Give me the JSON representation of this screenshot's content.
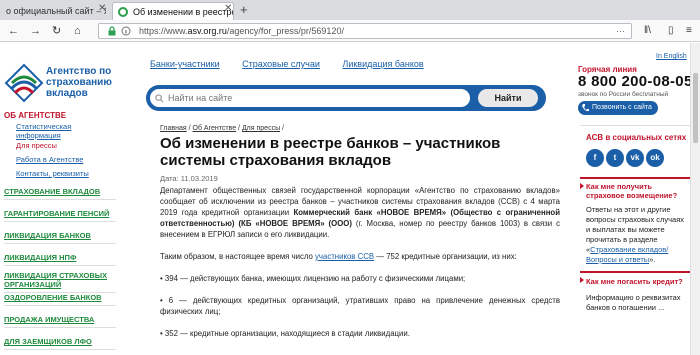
{
  "browser": {
    "tabs": [
      {
        "label": "о официальный сайт – Ян…",
        "active": false
      },
      {
        "label": "Об изменении в реестре банк…",
        "active": true
      }
    ],
    "url_scheme": "https://www.",
    "url_domain": "asv.org.ru",
    "url_path": "/agency/for_press/pr/569120/",
    "url_menu": "···"
  },
  "site": {
    "logo_text": "Агентство по страхованию вкладов",
    "top_links": [
      "Банки-участники",
      "Страховые случаи",
      "Ликвидация банков"
    ],
    "search": {
      "placeholder": "Найти на сайте",
      "button": "Найти"
    },
    "lang_link": "In English",
    "hotline_label": "Горячая линия",
    "phone": "8 800 200-08-05",
    "free_note": "звонок по России бесплатный",
    "callback_button": "Позвонить с сайта"
  },
  "left_menu": {
    "heading": "ОБ АГЕНТСТВЕ",
    "subitems": [
      "Статистическая информация",
      "Для прессы",
      "Работа в Агентстве",
      "Контакты, реквизиты"
    ],
    "items": [
      "СТРАХОВАНИЕ ВКЛАДОВ",
      "ГАРАНТИРОВАНИЕ ПЕНСИЙ",
      "ЛИКВИДАЦИЯ БАНКОВ",
      "ЛИКВИДАЦИЯ НПФ",
      "ЛИКВИДАЦИЯ СТРАХОВЫХ ОРГАНИЗАЦИЙ",
      "ОЗДОРОВЛЕНИЕ БАНКОВ",
      "ПРОДАЖА ИМУЩЕСТВА",
      "ДЛЯ ЗАЕМЩИКОВ ЛФО"
    ]
  },
  "article": {
    "breadcrumb": [
      "Главная",
      "Об Агентстве",
      "Для прессы"
    ],
    "title": "Об изменении в реестре банков – участников системы страхования вкладов",
    "date": "Дата: 11.03.2019",
    "p1_pre": "Департамент общественных связей государственной корпорации «Агентство по страхованию вкладов» сообщает об исключении из реестра банков – участников системы страхования вкладов (ССВ) с 4 марта 2019 года кредитной организации ",
    "p1_bold": "Коммерческий банк «НОВОЕ ВРЕМЯ» (Общество с ограниченной ответственностью) (КБ «НОВОЕ ВРЕМЯ» (ООО)",
    "p1_post": " (г. Москва, номер по реестру банков 1003) в связи с внесением в ЕГРЮЛ записи о его ликвидации.",
    "p2_pre": "Таким образом, в настоящее время число ",
    "p2_link": "участников ССВ",
    "p2_post": " — 752 кредитные организации, из них:",
    "p3": "• 394 — действующих банка, имеющих лицензию на работу с физическими лицами;",
    "p4": "• 6 — действующих кредитных организаций, утративших право на привлечение денежных средств физических лиц;",
    "p5": "• 352 — кредитные организации, находящиеся в стадии ликвидации."
  },
  "right_col": {
    "social_heading": "АСВ в социальных сетях",
    "social": [
      "f",
      "t",
      "vk",
      "ok"
    ],
    "q1": "Как мне получить страховое возмещение?",
    "a1_pre": "Ответы на этот и другие вопросы страховых случаях и выплатах вы можете прочитать в разделе «",
    "a1_link": "Страхование вкладов/Вопросы и ответы",
    "a1_post": "».",
    "q2": "Как мне погасить кредит?",
    "a2": "Информацию о реквизитах банков о погашении ..."
  },
  "colors": {
    "brand_blue": "#1a5fa8",
    "accent_red": "#c0142b",
    "menu_green": "#1e8a3c"
  }
}
